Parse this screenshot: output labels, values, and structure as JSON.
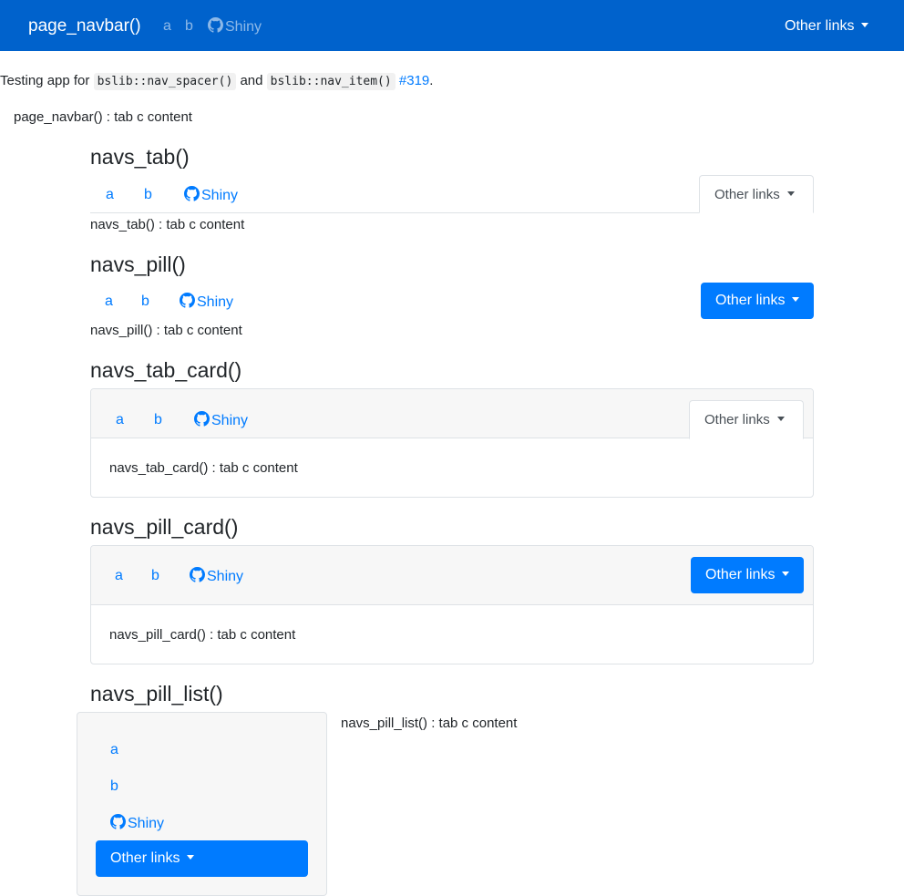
{
  "navbar": {
    "brand": "page_navbar()",
    "items": [
      {
        "label": "a"
      },
      {
        "label": "b"
      },
      {
        "label": "Shiny"
      }
    ],
    "other_links": "Other links",
    "background": "#0062cc"
  },
  "intro": {
    "prefix": "Testing app for ",
    "code1": "bslib::nav_spacer()",
    "and": " and ",
    "code2": "bslib::nav_item()",
    "issue": "#319",
    "suffix": "."
  },
  "page_content": "page_navbar() : tab c content",
  "sections": {
    "navs_tab": {
      "title": "navs_tab()",
      "items": [
        {
          "label": "a"
        },
        {
          "label": "b"
        },
        {
          "label": "Shiny"
        }
      ],
      "other_links": "Other links",
      "content": "navs_tab() : tab c content"
    },
    "navs_pill": {
      "title": "navs_pill()",
      "items": [
        {
          "label": "a"
        },
        {
          "label": "b"
        },
        {
          "label": "Shiny"
        }
      ],
      "other_links": "Other links",
      "content": "navs_pill() : tab c content"
    },
    "navs_tab_card": {
      "title": "navs_tab_card()",
      "items": [
        {
          "label": "a"
        },
        {
          "label": "b"
        },
        {
          "label": "Shiny"
        }
      ],
      "other_links": "Other links",
      "content": "navs_tab_card() : tab c content"
    },
    "navs_pill_card": {
      "title": "navs_pill_card()",
      "items": [
        {
          "label": "a"
        },
        {
          "label": "b"
        },
        {
          "label": "Shiny"
        }
      ],
      "other_links": "Other links",
      "content": "navs_pill_card() : tab c content"
    },
    "navs_pill_list": {
      "title": "navs_pill_list()",
      "items": [
        {
          "label": "a"
        },
        {
          "label": "b"
        },
        {
          "label": "Shiny"
        }
      ],
      "other_links": "Other links",
      "content": "navs_pill_list() : tab c content"
    }
  },
  "colors": {
    "accent": "#007bff",
    "navbar": "#0062cc",
    "card_header": "#f7f7f7",
    "border": "#dee2e6"
  },
  "icons": {
    "github": "github-icon",
    "caret": "caret-down-icon"
  }
}
